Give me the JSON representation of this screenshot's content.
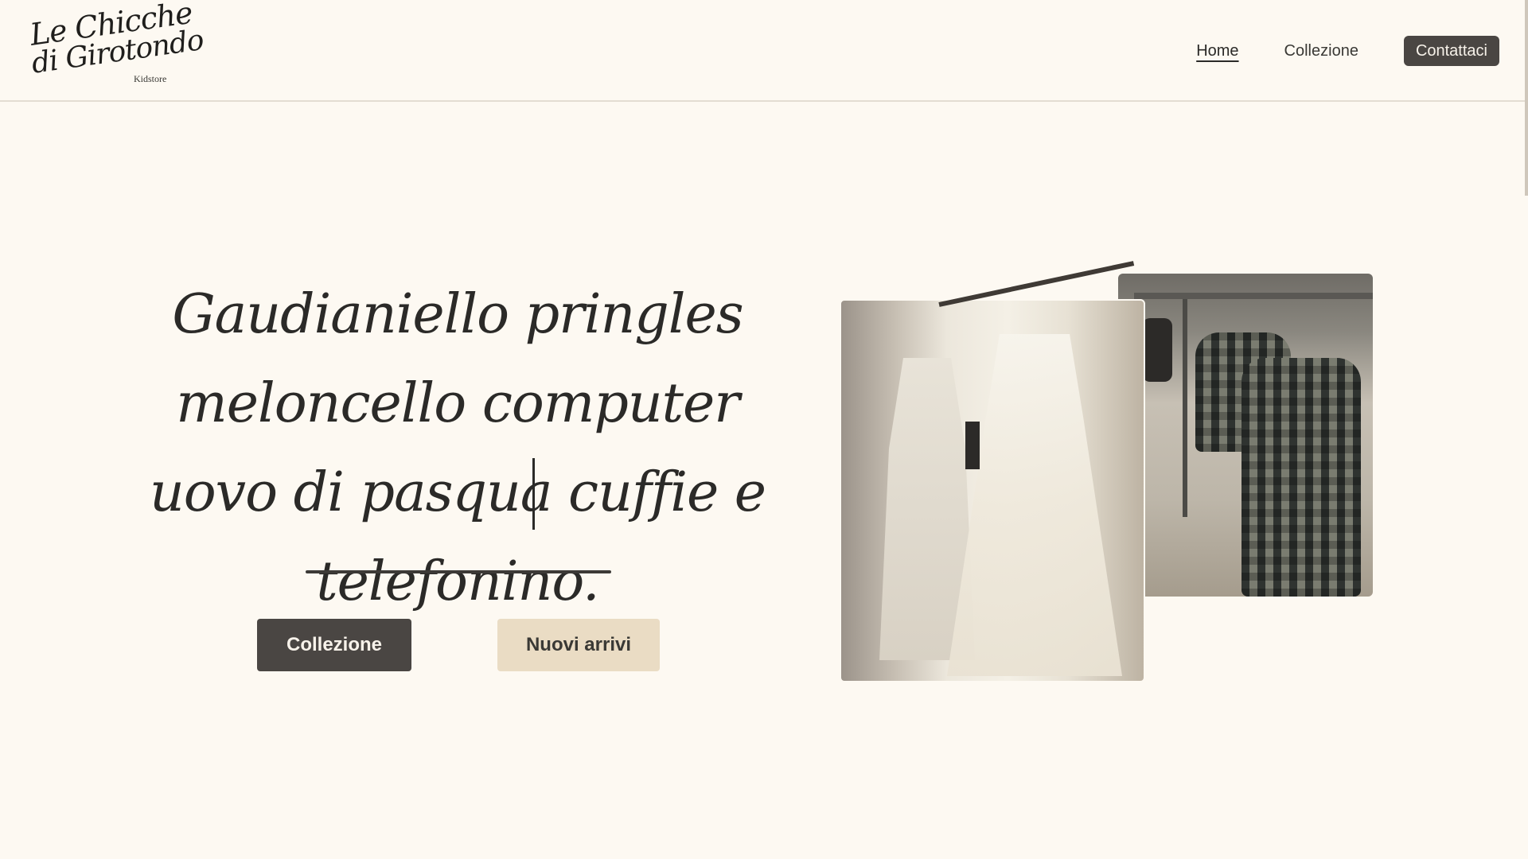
{
  "brand": {
    "logo_line1": "Le Chicche",
    "logo_line2": "di Girotondo",
    "logo_sub": "Kidstore"
  },
  "nav": {
    "home": "Home",
    "collection": "Collezione",
    "contact": "Contattaci"
  },
  "hero": {
    "title": "Gaudianiello pringles meloncello computer uovo di pasqua cuffie e telefonino.",
    "primary_button": "Collezione",
    "secondary_button": "Nuovi arrivi"
  },
  "colors": {
    "background": "#fdf9f2",
    "primary_button": "#4a4643",
    "secondary_button": "#eadcc4",
    "text": "#2b2a28"
  },
  "images": {
    "front_photo": "store-dresses-photo",
    "back_photo": "store-coats-photo"
  }
}
